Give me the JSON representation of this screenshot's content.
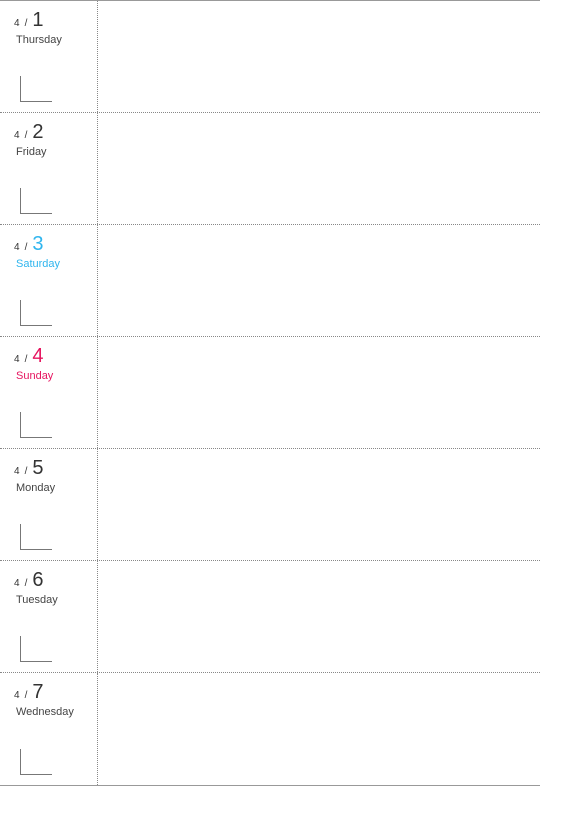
{
  "month": "4",
  "slash": "/",
  "days": [
    {
      "num": "1",
      "weekday": "Thursday",
      "class": ""
    },
    {
      "num": "2",
      "weekday": "Friday",
      "class": ""
    },
    {
      "num": "3",
      "weekday": "Saturday",
      "class": "sat"
    },
    {
      "num": "4",
      "weekday": "Sunday",
      "class": "sun"
    },
    {
      "num": "5",
      "weekday": "Monday",
      "class": ""
    },
    {
      "num": "6",
      "weekday": "Tuesday",
      "class": ""
    },
    {
      "num": "7",
      "weekday": "Wednesday",
      "class": ""
    }
  ]
}
